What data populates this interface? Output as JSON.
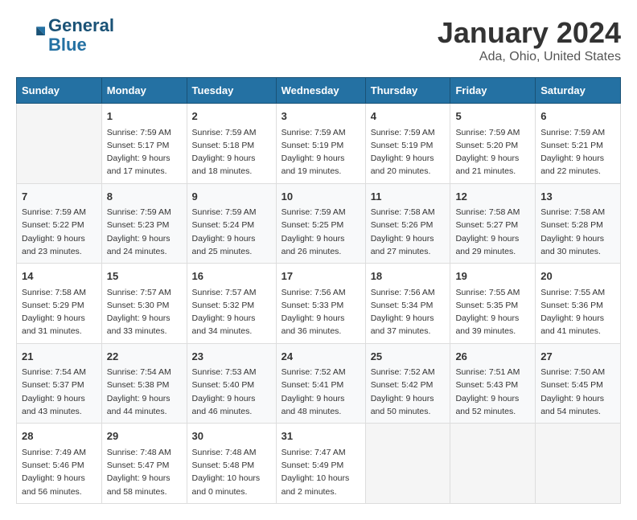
{
  "header": {
    "logo_line1": "General",
    "logo_line2": "Blue",
    "title": "January 2024",
    "subtitle": "Ada, Ohio, United States"
  },
  "columns": [
    "Sunday",
    "Monday",
    "Tuesday",
    "Wednesday",
    "Thursday",
    "Friday",
    "Saturday"
  ],
  "weeks": [
    [
      {
        "day": "",
        "info": ""
      },
      {
        "day": "1",
        "info": "Sunrise: 7:59 AM\nSunset: 5:17 PM\nDaylight: 9 hours\nand 17 minutes."
      },
      {
        "day": "2",
        "info": "Sunrise: 7:59 AM\nSunset: 5:18 PM\nDaylight: 9 hours\nand 18 minutes."
      },
      {
        "day": "3",
        "info": "Sunrise: 7:59 AM\nSunset: 5:19 PM\nDaylight: 9 hours\nand 19 minutes."
      },
      {
        "day": "4",
        "info": "Sunrise: 7:59 AM\nSunset: 5:19 PM\nDaylight: 9 hours\nand 20 minutes."
      },
      {
        "day": "5",
        "info": "Sunrise: 7:59 AM\nSunset: 5:20 PM\nDaylight: 9 hours\nand 21 minutes."
      },
      {
        "day": "6",
        "info": "Sunrise: 7:59 AM\nSunset: 5:21 PM\nDaylight: 9 hours\nand 22 minutes."
      }
    ],
    [
      {
        "day": "7",
        "info": "Sunrise: 7:59 AM\nSunset: 5:22 PM\nDaylight: 9 hours\nand 23 minutes."
      },
      {
        "day": "8",
        "info": "Sunrise: 7:59 AM\nSunset: 5:23 PM\nDaylight: 9 hours\nand 24 minutes."
      },
      {
        "day": "9",
        "info": "Sunrise: 7:59 AM\nSunset: 5:24 PM\nDaylight: 9 hours\nand 25 minutes."
      },
      {
        "day": "10",
        "info": "Sunrise: 7:59 AM\nSunset: 5:25 PM\nDaylight: 9 hours\nand 26 minutes."
      },
      {
        "day": "11",
        "info": "Sunrise: 7:58 AM\nSunset: 5:26 PM\nDaylight: 9 hours\nand 27 minutes."
      },
      {
        "day": "12",
        "info": "Sunrise: 7:58 AM\nSunset: 5:27 PM\nDaylight: 9 hours\nand 29 minutes."
      },
      {
        "day": "13",
        "info": "Sunrise: 7:58 AM\nSunset: 5:28 PM\nDaylight: 9 hours\nand 30 minutes."
      }
    ],
    [
      {
        "day": "14",
        "info": "Sunrise: 7:58 AM\nSunset: 5:29 PM\nDaylight: 9 hours\nand 31 minutes."
      },
      {
        "day": "15",
        "info": "Sunrise: 7:57 AM\nSunset: 5:30 PM\nDaylight: 9 hours\nand 33 minutes."
      },
      {
        "day": "16",
        "info": "Sunrise: 7:57 AM\nSunset: 5:32 PM\nDaylight: 9 hours\nand 34 minutes."
      },
      {
        "day": "17",
        "info": "Sunrise: 7:56 AM\nSunset: 5:33 PM\nDaylight: 9 hours\nand 36 minutes."
      },
      {
        "day": "18",
        "info": "Sunrise: 7:56 AM\nSunset: 5:34 PM\nDaylight: 9 hours\nand 37 minutes."
      },
      {
        "day": "19",
        "info": "Sunrise: 7:55 AM\nSunset: 5:35 PM\nDaylight: 9 hours\nand 39 minutes."
      },
      {
        "day": "20",
        "info": "Sunrise: 7:55 AM\nSunset: 5:36 PM\nDaylight: 9 hours\nand 41 minutes."
      }
    ],
    [
      {
        "day": "21",
        "info": "Sunrise: 7:54 AM\nSunset: 5:37 PM\nDaylight: 9 hours\nand 43 minutes."
      },
      {
        "day": "22",
        "info": "Sunrise: 7:54 AM\nSunset: 5:38 PM\nDaylight: 9 hours\nand 44 minutes."
      },
      {
        "day": "23",
        "info": "Sunrise: 7:53 AM\nSunset: 5:40 PM\nDaylight: 9 hours\nand 46 minutes."
      },
      {
        "day": "24",
        "info": "Sunrise: 7:52 AM\nSunset: 5:41 PM\nDaylight: 9 hours\nand 48 minutes."
      },
      {
        "day": "25",
        "info": "Sunrise: 7:52 AM\nSunset: 5:42 PM\nDaylight: 9 hours\nand 50 minutes."
      },
      {
        "day": "26",
        "info": "Sunrise: 7:51 AM\nSunset: 5:43 PM\nDaylight: 9 hours\nand 52 minutes."
      },
      {
        "day": "27",
        "info": "Sunrise: 7:50 AM\nSunset: 5:45 PM\nDaylight: 9 hours\nand 54 minutes."
      }
    ],
    [
      {
        "day": "28",
        "info": "Sunrise: 7:49 AM\nSunset: 5:46 PM\nDaylight: 9 hours\nand 56 minutes."
      },
      {
        "day": "29",
        "info": "Sunrise: 7:48 AM\nSunset: 5:47 PM\nDaylight: 9 hours\nand 58 minutes."
      },
      {
        "day": "30",
        "info": "Sunrise: 7:48 AM\nSunset: 5:48 PM\nDaylight: 10 hours\nand 0 minutes."
      },
      {
        "day": "31",
        "info": "Sunrise: 7:47 AM\nSunset: 5:49 PM\nDaylight: 10 hours\nand 2 minutes."
      },
      {
        "day": "",
        "info": ""
      },
      {
        "day": "",
        "info": ""
      },
      {
        "day": "",
        "info": ""
      }
    ]
  ]
}
